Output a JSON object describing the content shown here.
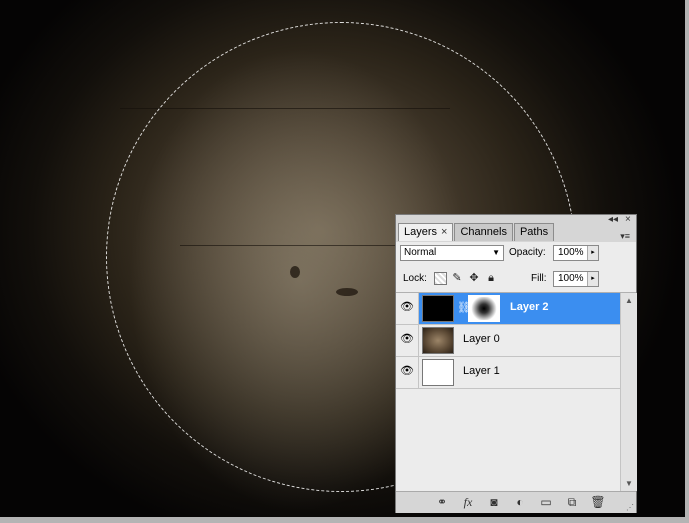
{
  "panel": {
    "tabs": [
      {
        "label": "Layers",
        "close": "×"
      },
      {
        "label": "Channels"
      },
      {
        "label": "Paths"
      }
    ],
    "title_buttons": {
      "collapse": "◂◂",
      "close": "×"
    },
    "menu_icon": "▾≡",
    "blend_mode": "Normal",
    "opacity_label": "Opacity:",
    "opacity_value": "100%",
    "lock_label": "Lock:",
    "fill_label": "Fill:",
    "fill_value": "100%",
    "layers": [
      {
        "name": "Layer 2",
        "selected": true
      },
      {
        "name": "Layer 0",
        "selected": false
      },
      {
        "name": "Layer 1",
        "selected": false
      }
    ],
    "bottom_icons": [
      "link-layers-icon",
      "fx-icon",
      "add-mask-icon",
      "adjustment-layer-icon",
      "new-group-icon",
      "new-layer-icon",
      "trash-icon"
    ]
  },
  "colors": {
    "selected_layer": "#3b8ef0"
  }
}
